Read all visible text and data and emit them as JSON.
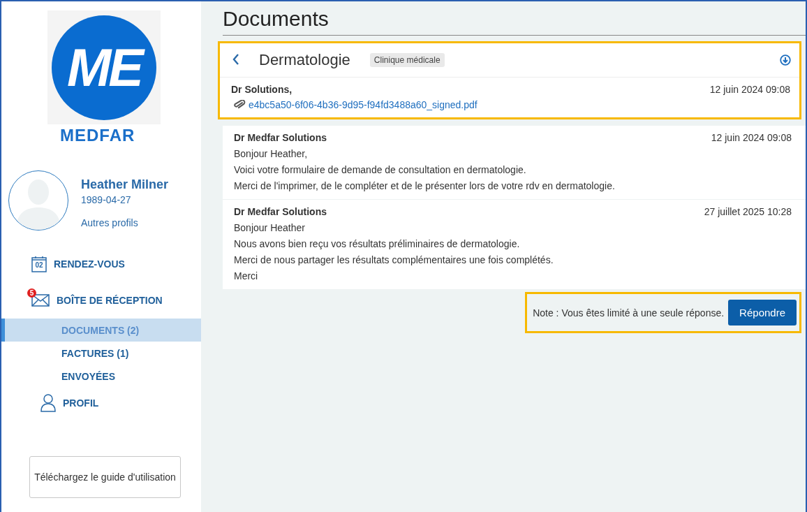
{
  "logo": {
    "mark": "ME",
    "wordmark": "MEDFAR"
  },
  "profile": {
    "name": "Heather Milner",
    "birthdate": "1989-04-27",
    "link": "Autres profils"
  },
  "nav": [
    {
      "label": "RENDEZ-VOUS",
      "kind": "calendar",
      "icon_text": "02"
    },
    {
      "label": "BOÎTE DE RÉCEPTION",
      "kind": "mail",
      "badge": "5",
      "children": [
        {
          "label": "DOCUMENTS (2)",
          "selected": true
        },
        {
          "label": "FACTURES (1)",
          "selected": false
        },
        {
          "label": "ENVOYÉES",
          "selected": false
        }
      ]
    },
    {
      "label": "PROFIL",
      "kind": "person"
    }
  ],
  "guide_button": "Téléchargez le guide d'utilisation",
  "page_title": "Documents",
  "thread": {
    "subject": "Dermatologie",
    "tag": "Clinique médicale",
    "highlighted": true,
    "attachment_message": {
      "sender": "Dr Solutions,",
      "date": "12 juin 2024 09:08",
      "file": "e4bc5a50-6f06-4b36-9d95-f94fd3488a60_signed.pdf"
    }
  },
  "messages": [
    {
      "sender": "Dr Medfar Solutions",
      "date": "12 juin 2024 09:08",
      "lines": [
        "Bonjour Heather,",
        "Voici votre formulaire de demande de consultation en dermatologie.",
        "Merci de l'imprimer, de le compléter et de le présenter lors de votre rdv en dermatologie."
      ]
    },
    {
      "sender": "Dr Medfar Solutions",
      "date": "27 juillet 2025 10:28",
      "lines": [
        "Bonjour Heather",
        "Nous avons bien reçu vos résultats préliminaires de dermatologie.",
        "Merci de nous partager les résultats complémentaires une fois complétés.",
        "Merci"
      ]
    }
  ],
  "reply": {
    "note": "Note : Vous êtes limité à une seule réponse.",
    "button": "Répondre",
    "highlighted": true
  }
}
